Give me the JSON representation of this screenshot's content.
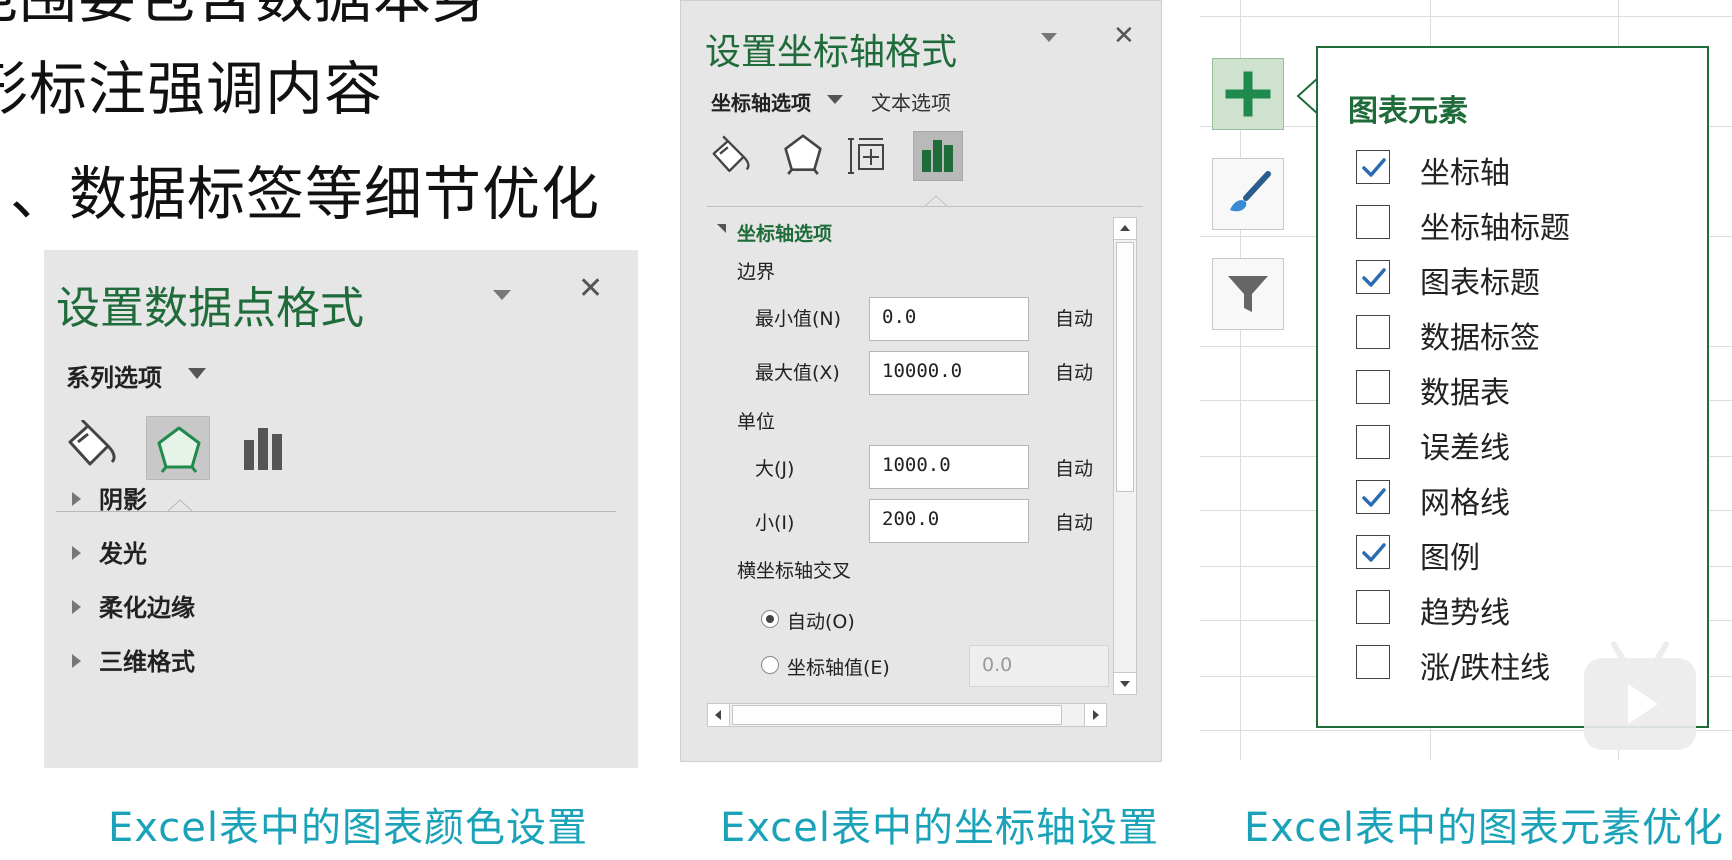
{
  "bullets": [
    "范围要包含数据本身",
    "形标注强调内容",
    "、数据标签等细节优化"
  ],
  "colors": {
    "title_green": "#1f6b3a",
    "caption_teal": "#1aa3b8",
    "pane_gray": "#e6e6e6"
  },
  "pane1": {
    "title": "设置数据点格式",
    "tab": "系列选项",
    "icons": [
      "fill-bucket-icon",
      "effects-pentagon-icon",
      "series-options-icon"
    ],
    "sections": [
      "阴影",
      "发光",
      "柔化边缘",
      "三维格式"
    ]
  },
  "pane2": {
    "title": "设置坐标轴格式",
    "tab_axis": "坐标轴选项",
    "tab_text": "文本选项",
    "icons": [
      "fill-bucket-icon",
      "effects-pentagon-icon",
      "size-properties-icon",
      "axis-options-icon"
    ],
    "section": "坐标轴选项",
    "bounds_label": "边界",
    "min_label": "最小值(N)",
    "min_value": "0.0",
    "max_label": "最大值(X)",
    "max_value": "10000.0",
    "units_label": "单位",
    "major_label": "大(J)",
    "major_value": "1000.0",
    "minor_label": "小(I)",
    "minor_value": "200.0",
    "auto_label": "自动",
    "cross_label": "横坐标轴交叉",
    "radio_auto": "自动(O)",
    "radio_axis_value": "坐标轴值(E)",
    "axis_value_field": "0.0"
  },
  "pane3": {
    "title": "图表元素",
    "side_buttons": [
      "add-chart-element-icon",
      "chart-styles-brush-icon",
      "chart-filter-icon"
    ],
    "items": [
      {
        "label": "坐标轴",
        "checked": true
      },
      {
        "label": "坐标轴标题",
        "checked": false
      },
      {
        "label": "图表标题",
        "checked": true
      },
      {
        "label": "数据标签",
        "checked": false
      },
      {
        "label": "数据表",
        "checked": false
      },
      {
        "label": "误差线",
        "checked": false
      },
      {
        "label": "网格线",
        "checked": true
      },
      {
        "label": "图例",
        "checked": true
      },
      {
        "label": "趋势线",
        "checked": false
      },
      {
        "label": "涨/跌柱线",
        "checked": false
      }
    ]
  },
  "captions": [
    "Excel表中的图表颜色设置",
    "Excel表中的坐标轴设置",
    "Excel表中的图表元素优化"
  ]
}
